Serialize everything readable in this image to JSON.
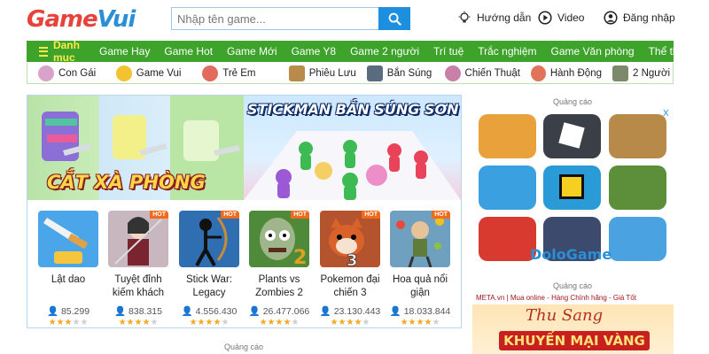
{
  "header": {
    "logo_part1": "Game",
    "logo_part2": "Vui",
    "search_placeholder": "Nhập tên game...",
    "links": [
      {
        "label": "Hướng dẫn",
        "icon": "lightbulb-icon"
      },
      {
        "label": "Video",
        "icon": "play-circle-icon"
      },
      {
        "label": "Đăng nhập",
        "icon": "user-circle-icon"
      }
    ]
  },
  "nav": {
    "menu_label": "Danh mục",
    "items": [
      "Game Hay",
      "Game Hot",
      "Game Mới",
      "Game Y8",
      "Game 2 người",
      "Trí tuệ",
      "Trắc nghiệm",
      "Game Văn phòng",
      "Thể thao"
    ]
  },
  "categories": [
    {
      "label": "Con Gái",
      "color": "#d9a3c9"
    },
    {
      "label": "Game Vui",
      "color": "#f2c230"
    },
    {
      "label": "Trẻ Em",
      "color": "#e26b5e"
    },
    {
      "label": "Phiêu Lưu",
      "color": "#b98b4a"
    },
    {
      "label": "Bắn Súng",
      "color": "#5a6c80"
    },
    {
      "label": "Chiến Thuật",
      "color": "#c97fa8"
    },
    {
      "label": "Hành Động",
      "color": "#e0735a"
    },
    {
      "label": "2 Người",
      "color": "#7a8a6a"
    }
  ],
  "banners": {
    "left_title": "CẮT XÀ PHÒNG",
    "right_title": "STICKMAN BẮN SÚNG SƠN"
  },
  "games": [
    {
      "name": "Lật dao",
      "plays": "85.299",
      "rating": 3,
      "hot": false,
      "color": "#4aa6e8"
    },
    {
      "name": "Tuyệt đỉnh kiếm khách",
      "plays": "838.315",
      "rating": 4,
      "hot": true,
      "color": "#c9b7c0"
    },
    {
      "name": "Stick War: Legacy",
      "plays": "4.556.430",
      "rating": 4,
      "hot": true,
      "color": "#2f6fb1"
    },
    {
      "name": "Plants vs Zombies 2",
      "plays": "26.477.066",
      "rating": 4,
      "hot": true,
      "color": "#4f8a3a"
    },
    {
      "name": "Pokemon đại chiến 3",
      "plays": "23.130.443",
      "rating": 4,
      "hot": true,
      "color": "#b3542e"
    },
    {
      "name": "Hoa quả nổi giận",
      "plays": "18.033.844",
      "rating": 4,
      "hot": true,
      "color": "#6fa0c0"
    }
  ],
  "ads": {
    "label": "Quảng cáo",
    "apps": [
      {
        "name": "subway-surfers",
        "color": "#e9a23b"
      },
      {
        "name": "roblox",
        "color": "#3b3f47"
      },
      {
        "name": "rise-of-kingdoms",
        "color": "#b88a4a"
      },
      {
        "name": "royal-match",
        "color": "#3aa0e0"
      },
      {
        "name": "geometry-dash",
        "color": "#2b9bd8"
      },
      {
        "name": "minecraft",
        "color": "#5d8e3a"
      },
      {
        "name": "among-us",
        "color": "#d93a30"
      },
      {
        "name": "dark-game",
        "color": "#3c4a6e"
      },
      {
        "name": "fortnite",
        "color": "#4aa3e0"
      }
    ],
    "ad_choice": "X",
    "brand": "DoloGame",
    "banner3_top": "META.vn | Mua online - Hàng Chính hãng - Giá Tốt",
    "banner3_script": "Thu Sang",
    "banner3_bottom": "KHUYẾN MẠI VÀNG"
  },
  "footer_ad_label": "Quảng cáo"
}
